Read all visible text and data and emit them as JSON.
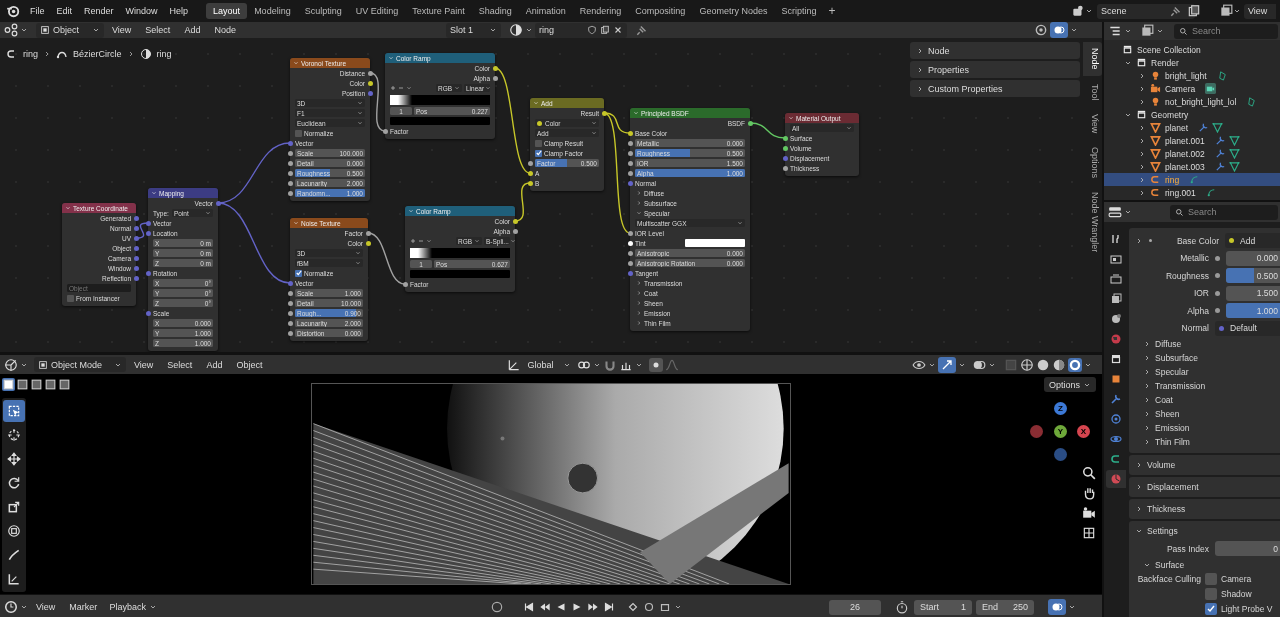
{
  "top_bar": {
    "menus": [
      "File",
      "Edit",
      "Render",
      "Window",
      "Help"
    ],
    "workspaces": [
      {
        "label": "Layout",
        "selected": true
      },
      {
        "label": "Modeling",
        "selected": false
      },
      {
        "label": "Sculpting",
        "selected": false
      },
      {
        "label": "UV Editing",
        "selected": false
      },
      {
        "label": "Texture Paint",
        "selected": false
      },
      {
        "label": "Shading",
        "selected": false
      },
      {
        "label": "Animation",
        "selected": false
      },
      {
        "label": "Rendering",
        "selected": false
      },
      {
        "label": "Compositing",
        "selected": false
      },
      {
        "label": "Geometry Nodes",
        "selected": false
      },
      {
        "label": "Scripting",
        "selected": false
      }
    ],
    "add_workspace": "+",
    "scene": "Scene",
    "view_layer": "View"
  },
  "node_editor": {
    "header": {
      "mode": "Object",
      "menus": [
        "View",
        "Select",
        "Add",
        "Node"
      ],
      "slot": "Slot 1",
      "material": "ring"
    },
    "breadcrumbs": [
      "ring",
      "BézierCircle",
      "ring"
    ],
    "nodes": [
      {
        "title": "Texture Coordinate",
        "color": "#83314a",
        "rows": [
          {
            "kind": "output",
            "label": "Generated",
            "color": "#6363c7"
          },
          {
            "kind": "output",
            "label": "Normal",
            "color": "#6363c7"
          },
          {
            "kind": "output",
            "label": "UV",
            "color": "#6363c7"
          },
          {
            "kind": "output",
            "label": "Object",
            "color": "#6363c7"
          },
          {
            "kind": "output",
            "label": "Camera",
            "color": "#6363c7"
          },
          {
            "kind": "output",
            "label": "Window",
            "color": "#6363c7"
          },
          {
            "kind": "output",
            "label": "Reflection",
            "color": "#6363c7"
          },
          {
            "kind": "object_field",
            "placeholder": "Object"
          },
          {
            "kind": "checkbox",
            "label": "From Instancer",
            "checked": false
          }
        ]
      },
      {
        "title": "Mapping",
        "color": "#3c3c83",
        "rows": [
          {
            "kind": "output",
            "label": "Vector",
            "color": "#6363c7"
          },
          {
            "kind": "labeled_dropdown",
            "label": "Type:",
            "value": "Point"
          },
          {
            "kind": "input",
            "label": "Vector",
            "color": "#6363c7"
          },
          {
            "kind": "input",
            "label": "Location",
            "color": "#6363c7"
          },
          {
            "kind": "field",
            "label": "X",
            "value": "0 m"
          },
          {
            "kind": "field",
            "label": "Y",
            "value": "0 m"
          },
          {
            "kind": "field",
            "label": "Z",
            "value": "0 m"
          },
          {
            "kind": "input",
            "label": "Rotation",
            "color": "#6363c7"
          },
          {
            "kind": "field",
            "label": "X",
            "value": "0°"
          },
          {
            "kind": "field",
            "label": "Y",
            "value": "0°"
          },
          {
            "kind": "field",
            "label": "Z",
            "value": "0°"
          },
          {
            "kind": "input",
            "label": "Scale",
            "color": "#6363c7"
          },
          {
            "kind": "field",
            "label": "X",
            "value": "0.000"
          },
          {
            "kind": "field",
            "label": "Y",
            "value": "1.000"
          },
          {
            "kind": "field",
            "label": "Z",
            "value": "1.000"
          }
        ]
      },
      {
        "title": "Voronoi Texture",
        "color": "#8a4a1c",
        "rows": [
          {
            "kind": "output",
            "label": "Distance",
            "color": "#a1a1a1"
          },
          {
            "kind": "output",
            "label": "Color",
            "color": "#c7c729"
          },
          {
            "kind": "output",
            "label": "Position",
            "color": "#6363c7"
          },
          {
            "kind": "dropdown",
            "value": "3D"
          },
          {
            "kind": "dropdown",
            "value": "F1"
          },
          {
            "kind": "dropdown",
            "value": "Euclidean"
          },
          {
            "kind": "checkbox",
            "label": "Normalize",
            "checked": false
          },
          {
            "kind": "input",
            "label": "Vector",
            "color": "#6363c7"
          },
          {
            "kind": "field",
            "label": "Scale",
            "value": "100.000",
            "color": "#a1a1a1"
          },
          {
            "kind": "field",
            "label": "Detail",
            "value": "0.000",
            "color": "#a1a1a1"
          },
          {
            "kind": "field",
            "label": "Roughness",
            "value": "0.500",
            "level": 0.5,
            "color": "#a1a1a1"
          },
          {
            "kind": "field",
            "label": "Lacunarity",
            "value": "2.000",
            "color": "#a1a1a1"
          },
          {
            "kind": "field",
            "label": "Randomn...",
            "value": "1.000",
            "level": 1,
            "color": "#a1a1a1"
          }
        ]
      },
      {
        "title": "Color Ramp",
        "color": "#1f5f7a",
        "rows": [
          {
            "kind": "output",
            "label": "Color",
            "color": "#c7c729"
          },
          {
            "kind": "output",
            "label": "Alpha",
            "color": "#a1a1a1"
          },
          {
            "kind": "ramp_tools",
            "mode": "RGB",
            "interpolation": "Linear"
          },
          {
            "kind": "ramp"
          },
          {
            "kind": "pos_row",
            "index": "1",
            "label": "Pos",
            "value": "0.227"
          },
          {
            "kind": "swatch",
            "color": "#000000"
          },
          {
            "kind": "input",
            "label": "Factor",
            "color": "#a1a1a1"
          }
        ]
      },
      {
        "title": "Noise Texture",
        "color": "#8a4a1c",
        "rows": [
          {
            "kind": "output",
            "label": "Factor",
            "color": "#a1a1a1"
          },
          {
            "kind": "output",
            "label": "Color",
            "color": "#c7c729"
          },
          {
            "kind": "dropdown",
            "value": "3D"
          },
          {
            "kind": "dropdown",
            "value": "fBM"
          },
          {
            "kind": "checkbox",
            "label": "Normalize",
            "checked": true
          },
          {
            "kind": "input",
            "label": "Vector",
            "color": "#6363c7"
          },
          {
            "kind": "field",
            "label": "Scale",
            "value": "1.000",
            "color": "#a1a1a1"
          },
          {
            "kind": "field",
            "label": "Detail",
            "value": "10.000",
            "color": "#a1a1a1"
          },
          {
            "kind": "field",
            "label": "Rough...",
            "value": "0.900",
            "level": 0.9,
            "color": "#a1a1a1"
          },
          {
            "kind": "field",
            "label": "Lacunarity",
            "value": "2.000",
            "color": "#a1a1a1"
          },
          {
            "kind": "field",
            "label": "Distortion",
            "value": "0.000",
            "color": "#a1a1a1"
          }
        ]
      },
      {
        "title": "Color Ramp",
        "color": "#1f5f7a",
        "rows": [
          {
            "kind": "output",
            "label": "Color",
            "color": "#c7c729"
          },
          {
            "kind": "output",
            "label": "Alpha",
            "color": "#a1a1a1"
          },
          {
            "kind": "ramp_tools",
            "mode": "RGB",
            "interpolation": "B-Spli..."
          },
          {
            "kind": "ramp"
          },
          {
            "kind": "pos_row",
            "index": "1",
            "label": "Pos",
            "value": "0.627"
          },
          {
            "kind": "swatch",
            "color": "#000000"
          },
          {
            "kind": "input",
            "label": "Factor",
            "color": "#a1a1a1"
          }
        ]
      },
      {
        "title": "Add",
        "color": "#6b6b22",
        "rows": [
          {
            "kind": "output",
            "label": "Result",
            "color": "#c7c729"
          },
          {
            "kind": "dropdown",
            "value": "Color",
            "color": "#c7c729"
          },
          {
            "kind": "dropdown",
            "value": "Add"
          },
          {
            "kind": "checkbox",
            "label": "Clamp Result",
            "checked": false
          },
          {
            "kind": "checkbox",
            "label": "Clamp Factor",
            "checked": true
          },
          {
            "kind": "field",
            "label": "Factor",
            "value": "0.500",
            "level": 0.5,
            "color": "#a1a1a1"
          },
          {
            "kind": "input",
            "label": "A",
            "color": "#c7c729"
          },
          {
            "kind": "input",
            "label": "B",
            "color": "#c7c729"
          }
        ]
      },
      {
        "title": "Principled BSDF",
        "color": "#2b6b2b",
        "rows": [
          {
            "kind": "output",
            "label": "BSDF",
            "color": "#63c763"
          },
          {
            "kind": "input",
            "label": "Base Color",
            "color": "#c7c729"
          },
          {
            "kind": "field",
            "label": "Metallic",
            "value": "0.000",
            "color": "#a1a1a1"
          },
          {
            "kind": "field",
            "label": "Roughness",
            "value": "0.500",
            "level": 0.5,
            "color": "#a1a1a1"
          },
          {
            "kind": "field",
            "label": "IOR",
            "value": "1.500",
            "color": "#a1a1a1"
          },
          {
            "kind": "field",
            "label": "Alpha",
            "value": "1.000",
            "level": 1,
            "color": "#a1a1a1"
          },
          {
            "kind": "input",
            "label": "Normal",
            "color": "#6363c7"
          },
          {
            "kind": "panel",
            "label": "Diffuse",
            "expanded": false
          },
          {
            "kind": "panel",
            "label": "Subsurface",
            "expanded": false
          },
          {
            "kind": "panel",
            "label": "Specular",
            "expanded": true
          },
          {
            "kind": "dropdown",
            "value": "Multiscatter GGX"
          },
          {
            "kind": "input",
            "label": "IOR Level",
            "color": "#a1a1a1"
          },
          {
            "kind": "color_input",
            "label": "Tint",
            "color": "#ffffff"
          },
          {
            "kind": "field",
            "label": "Anisotropic",
            "value": "0.000",
            "color": "#a1a1a1"
          },
          {
            "kind": "field",
            "label": "Anisotropic Rotation",
            "value": "0.000",
            "color": "#a1a1a1"
          },
          {
            "kind": "input",
            "label": "Tangent",
            "color": "#6363c7"
          },
          {
            "kind": "panel",
            "label": "Transmission",
            "expanded": false
          },
          {
            "kind": "panel",
            "label": "Coat",
            "expanded": false
          },
          {
            "kind": "panel",
            "label": "Sheen",
            "expanded": false
          },
          {
            "kind": "panel",
            "label": "Emission",
            "expanded": false
          },
          {
            "kind": "panel",
            "label": "Thin Film",
            "expanded": false
          }
        ]
      },
      {
        "title": "Material Output",
        "color": "#6b2b33",
        "rows": [
          {
            "kind": "dropdown",
            "value": "All"
          },
          {
            "kind": "input",
            "label": "Surface",
            "color": "#63c763"
          },
          {
            "kind": "input",
            "label": "Volume",
            "color": "#63c763"
          },
          {
            "kind": "input",
            "label": "Displacement",
            "color": "#6363c7"
          },
          {
            "kind": "input",
            "label": "Thickness",
            "color": "#a1a1a1"
          }
        ]
      }
    ],
    "sidebar": {
      "panels": [
        "Node",
        "Properties",
        "Custom Properties"
      ],
      "tabs": [
        {
          "label": "Node",
          "selected": true
        },
        {
          "label": "Tool",
          "selected": false
        },
        {
          "label": "View",
          "selected": false
        },
        {
          "label": "Options",
          "selected": false
        },
        {
          "label": "Node Wrangler",
          "selected": false
        }
      ]
    }
  },
  "viewport": {
    "header": {
      "mode": "Object Mode",
      "menus": [
        "View",
        "Select",
        "Add",
        "Object"
      ],
      "orientation": "Global"
    },
    "options": "Options",
    "tools": [
      {
        "kind": "select",
        "selected": true
      },
      {
        "kind": "cursor",
        "selected": false
      },
      {
        "kind": "move",
        "selected": false
      },
      {
        "kind": "rotate",
        "selected": false
      },
      {
        "kind": "scale",
        "selected": false
      },
      {
        "kind": "transform",
        "selected": false
      },
      {
        "kind": "annotate",
        "selected": false
      },
      {
        "kind": "measure",
        "selected": false
      }
    ],
    "gizmo_axes": [
      "Z",
      "Y",
      "X"
    ]
  },
  "timeline": {
    "menus": [
      "View",
      "Marker",
      "Playback"
    ],
    "current_frame": "26",
    "start_label": "Start",
    "start": "1",
    "end_label": "End",
    "end": "250"
  },
  "outliner": {
    "search_placeholder": "Search",
    "items": [
      {
        "label": "Scene Collection",
        "kind": "collection",
        "selected": false,
        "children": [
          {
            "label": "Render",
            "kind": "collection",
            "selected": false,
            "expanded": true,
            "children": [
              {
                "label": "bright_light",
                "kind": "light",
                "selected": false,
                "expanded": false
              },
              {
                "label": "Camera",
                "kind": "camera",
                "selected": false,
                "expanded": false
              },
              {
                "label": "not_bright_light_lol",
                "kind": "light",
                "selected": false,
                "expanded": false
              }
            ]
          },
          {
            "label": "Geometry",
            "kind": "collection",
            "selected": false,
            "expanded": true,
            "children": [
              {
                "label": "planet",
                "kind": "mesh",
                "selected": false,
                "expanded": false
              },
              {
                "label": "planet.001",
                "kind": "mesh",
                "selected": false,
                "expanded": false
              },
              {
                "label": "planet.002",
                "kind": "mesh",
                "selected": false,
                "expanded": false
              },
              {
                "label": "planet.003",
                "kind": "mesh",
                "selected": false,
                "expanded": false
              },
              {
                "label": "ring",
                "kind": "curve",
                "selected": true,
                "expanded": false
              },
              {
                "label": "ring.001",
                "kind": "curve",
                "selected": false,
                "expanded": false
              }
            ]
          }
        ]
      }
    ]
  },
  "properties": {
    "search_placeholder": "Search",
    "tabs": [
      {
        "kind": "tool",
        "selected": false
      },
      {
        "kind": "render",
        "selected": false
      },
      {
        "kind": "output",
        "selected": false
      },
      {
        "kind": "view_layer",
        "selected": false
      },
      {
        "kind": "scene",
        "selected": false
      },
      {
        "kind": "world",
        "selected": false
      },
      {
        "kind": "collection",
        "selected": false
      },
      {
        "kind": "object",
        "selected": false
      },
      {
        "kind": "modifiers",
        "selected": false
      },
      {
        "kind": "particles",
        "selected": false
      },
      {
        "kind": "physics",
        "selected": false
      },
      {
        "kind": "data",
        "selected": false
      },
      {
        "kind": "material",
        "selected": true
      }
    ],
    "rows": [
      {
        "kind": "link",
        "label": "Base Color",
        "value": "Add",
        "color": "#c7c729",
        "expanded": false
      },
      {
        "kind": "value",
        "label": "Metallic",
        "value": "0.000"
      },
      {
        "kind": "value",
        "label": "Roughness",
        "value": "0.500",
        "level": 0.5
      },
      {
        "kind": "value",
        "label": "IOR",
        "value": "1.500"
      },
      {
        "kind": "value",
        "label": "Alpha",
        "value": "1.000",
        "level": 1
      },
      {
        "kind": "link",
        "label": "Normal",
        "value": "Default",
        "color": "#6363c7"
      },
      {
        "kind": "subpanel",
        "label": "Diffuse",
        "expanded": false
      },
      {
        "kind": "subpanel",
        "label": "Subsurface",
        "expanded": false
      },
      {
        "kind": "subpanel",
        "label": "Specular",
        "expanded": false
      },
      {
        "kind": "subpanel",
        "label": "Transmission",
        "expanded": false
      },
      {
        "kind": "subpanel",
        "label": "Coat",
        "expanded": false
      },
      {
        "kind": "subpanel",
        "label": "Sheen",
        "expanded": false
      },
      {
        "kind": "subpanel",
        "label": "Emission",
        "expanded": false
      },
      {
        "kind": "subpanel",
        "label": "Thin Film",
        "expanded": false
      },
      {
        "kind": "panel",
        "label": "Volume",
        "expanded": false
      },
      {
        "kind": "panel",
        "label": "Displacement",
        "expanded": false
      },
      {
        "kind": "panel",
        "label": "Thickness",
        "expanded": false
      },
      {
        "kind": "panel",
        "label": "Settings",
        "expanded": true,
        "children": [
          {
            "kind": "value",
            "label": "Pass Index",
            "value": "0"
          },
          {
            "kind": "subpanel",
            "label": "Surface",
            "expanded": true,
            "children": [
              {
                "kind": "checkbox",
                "label": "Backface Culling",
                "option": "Camera",
                "checked": false
              },
              {
                "kind": "checkbox",
                "option": "Shadow",
                "checked": false
              },
              {
                "kind": "checkbox",
                "option": "Light Probe V",
                "checked": true
              }
            ]
          }
        ]
      }
    ]
  }
}
